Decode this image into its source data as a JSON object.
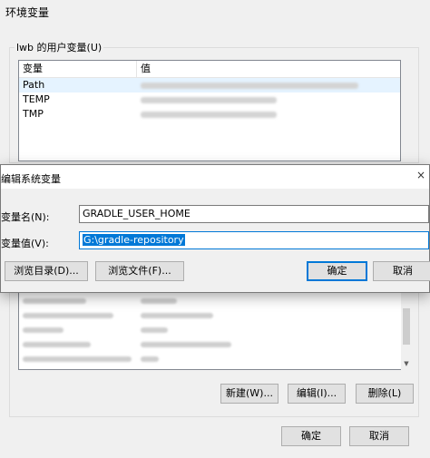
{
  "bg_window": {
    "title": "环境变量",
    "user_group_label": "lwb 的用户变量(U)",
    "columns": [
      "变量",
      "值"
    ],
    "user_vars": [
      {
        "name": "Path"
      },
      {
        "name": "TEMP"
      },
      {
        "name": "TMP"
      }
    ],
    "system_buttons": {
      "new": "新建(W)...",
      "edit": "编辑(I)...",
      "delete": "删除(L)"
    },
    "ok": "确定",
    "cancel": "取消"
  },
  "dialog": {
    "title": "编辑系统变量",
    "close_glyph": "×",
    "name_label": "变量名(N):",
    "name_value": "GRADLE_USER_HOME",
    "value_label": "变量值(V):",
    "value_value": "G:\\gradle-repository",
    "browse_dir": "浏览目录(D)...",
    "browse_file": "浏览文件(F)...",
    "ok": "确定",
    "cancel": "取消"
  },
  "colors": {
    "accent": "#0078d7",
    "window_bg": "#f0f0f0",
    "selection_row": "#e5f3ff"
  },
  "icons": {
    "close": "close-icon",
    "scroll_up": "chevron-up-icon",
    "scroll_down": "chevron-down-icon"
  }
}
